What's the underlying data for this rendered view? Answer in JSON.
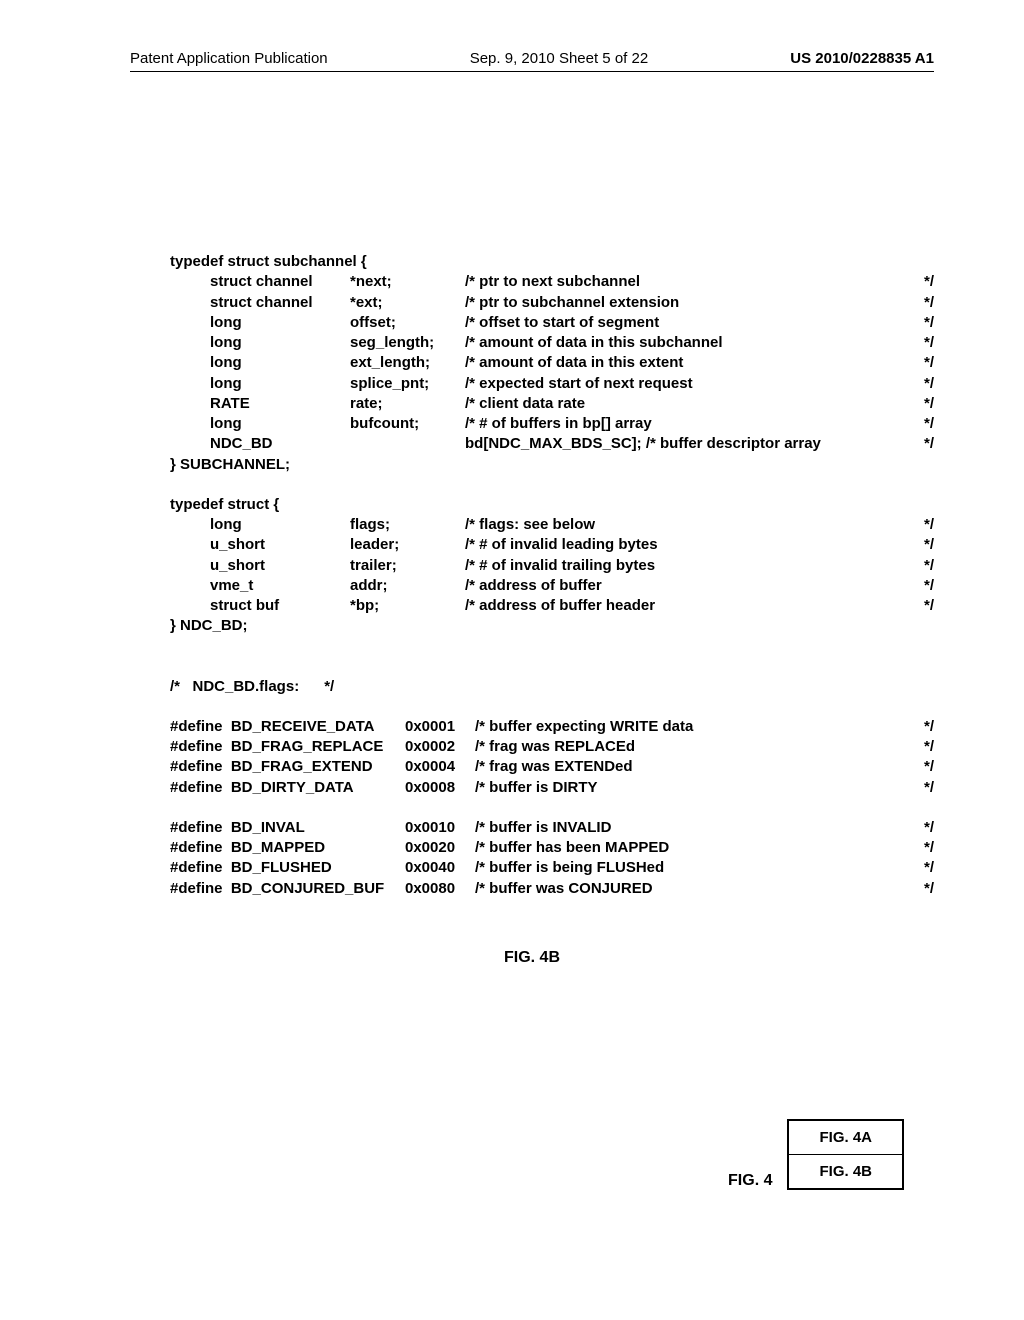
{
  "header": {
    "left": "Patent Application Publication",
    "mid": "Sep. 9, 2010  Sheet 5 of 22",
    "right": "US 2010/0228835 A1"
  },
  "struct1": {
    "decl": "typedef struct subchannel {",
    "rows": [
      {
        "type": "struct channel",
        "name": "*next;",
        "comment": "/* ptr to next subchannel",
        "end": "*/"
      },
      {
        "type": "struct channel",
        "name": "*ext;",
        "comment": "/* ptr to subchannel extension",
        "end": "*/"
      },
      {
        "type": "long",
        "name": "offset;",
        "comment": "/* offset to start of segment",
        "end": "*/"
      },
      {
        "type": "long",
        "name": "seg_length;",
        "comment": "/* amount of data in this subchannel",
        "end": "*/"
      },
      {
        "type": "long",
        "name": "ext_length;",
        "comment": "/* amount of data in this extent",
        "end": "*/"
      },
      {
        "type": "long",
        "name": "splice_pnt;",
        "comment": "/* expected start of next request",
        "end": "*/"
      },
      {
        "type": "RATE",
        "name": "rate;",
        "comment": "/* client data rate",
        "end": "*/"
      },
      {
        "type": "long",
        "name": "bufcount;",
        "comment": "/* # of buffers in bp[] array",
        "end": "*/"
      },
      {
        "type": "NDC_BD",
        "name": "",
        "comment": "bd[NDC_MAX_BDS_SC]; /* buffer descriptor array",
        "end": "*/"
      }
    ],
    "close": "} SUBCHANNEL;"
  },
  "struct2": {
    "decl": "typedef struct {",
    "rows": [
      {
        "type": "long",
        "name": "flags;",
        "comment": "/* flags: see below",
        "end": "*/"
      },
      {
        "type": "u_short",
        "name": "leader;",
        "comment": "/* # of invalid leading bytes",
        "end": "*/"
      },
      {
        "type": "u_short",
        "name": "trailer;",
        "comment": "/* # of invalid trailing bytes",
        "end": "*/"
      },
      {
        "type": "vme_t",
        "name": "addr;",
        "comment": "/* address of buffer",
        "end": "*/"
      },
      {
        "type": "struct buf",
        "name": "*bp;",
        "comment": "/* address of buffer header",
        "end": "*/"
      }
    ],
    "close": "} NDC_BD;"
  },
  "flags_comment": "/*   NDC_BD.flags:      */",
  "defines1": [
    {
      "def": "#define  BD_RECEIVE_DATA",
      "hex": "0x0001",
      "comment": "/* buffer expecting WRITE data",
      "end": "*/"
    },
    {
      "def": "#define  BD_FRAG_REPLACE",
      "hex": "0x0002",
      "comment": "/* frag was REPLACEd",
      "end": "*/"
    },
    {
      "def": "#define  BD_FRAG_EXTEND",
      "hex": "0x0004",
      "comment": "/* frag was EXTENDed",
      "end": "*/"
    },
    {
      "def": "#define  BD_DIRTY_DATA",
      "hex": "0x0008",
      "comment": "/* buffer is DIRTY",
      "end": "*/"
    }
  ],
  "defines2": [
    {
      "def": "#define  BD_INVAL",
      "hex": "0x0010",
      "comment": "/* buffer is INVALID",
      "end": "*/"
    },
    {
      "def": "#define  BD_MAPPED",
      "hex": "0x0020",
      "comment": "/* buffer has been MAPPED",
      "end": "*/"
    },
    {
      "def": "#define  BD_FLUSHED",
      "hex": "0x0040",
      "comment": "/* buffer is being FLUSHed",
      "end": "*/"
    },
    {
      "def": "#define  BD_CONJURED_BUF",
      "hex": "0x0080",
      "comment": "/* buffer was CONJURED",
      "end": "*/"
    }
  ],
  "figure": {
    "main_label": "FIG. 4B",
    "panel_label": "FIG. 4",
    "cells": [
      "FIG. 4A",
      "FIG. 4B"
    ]
  }
}
